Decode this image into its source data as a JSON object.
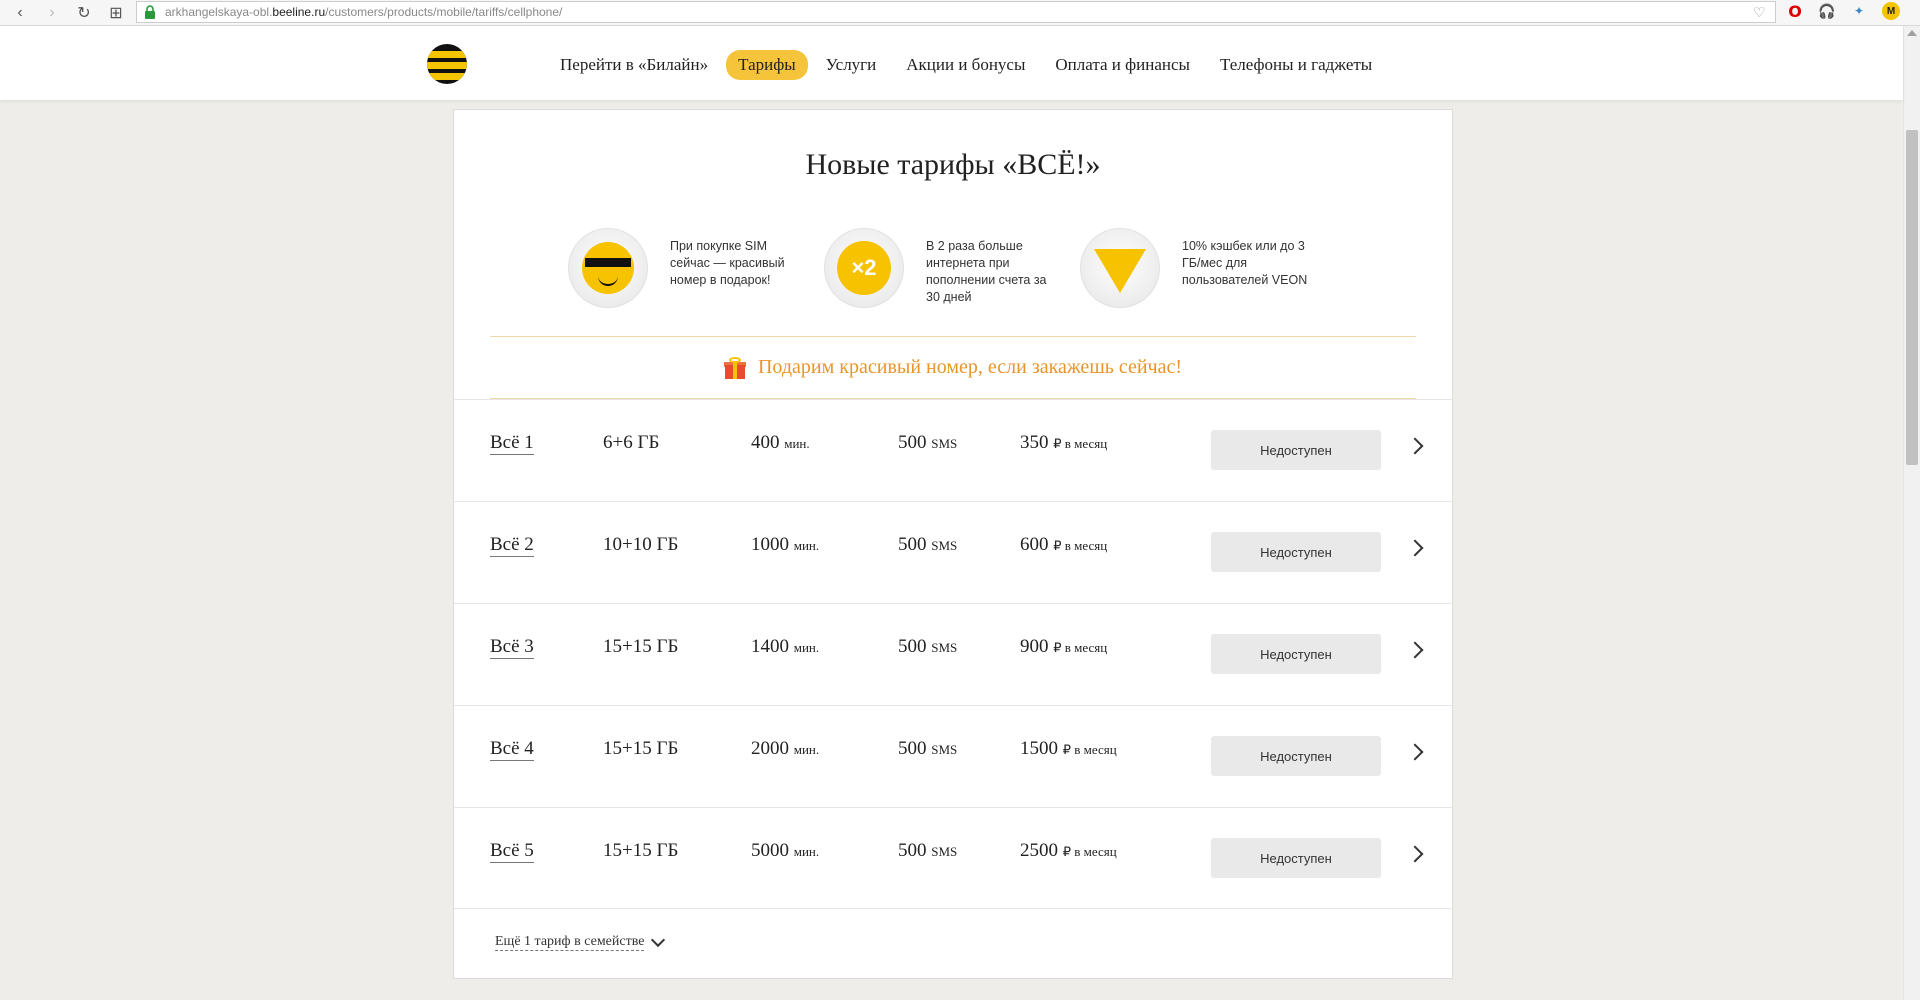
{
  "browser": {
    "url_prefix": "arkhangelskaya-obl.",
    "url_host": "beeline.ru",
    "url_path": "/customers/products/mobile/tariffs/cellphone/",
    "ext_badge_letter": "M"
  },
  "header": {
    "nav": [
      {
        "label": "Перейти в «Билайн»",
        "active": false
      },
      {
        "label": "Тарифы",
        "active": true
      },
      {
        "label": "Услуги",
        "active": false
      },
      {
        "label": "Акции и бонусы",
        "active": false
      },
      {
        "label": "Оплата и финансы",
        "active": false
      },
      {
        "label": "Телефоны и гаджеты",
        "active": false
      }
    ]
  },
  "card": {
    "title": "Новые тарифы «ВСЁ!»",
    "perks": [
      {
        "icon": "smiley-sunglasses-icon",
        "text": "При покупке SIM сейчас — красивый номер в подарок!"
      },
      {
        "icon": "x2-badge-icon",
        "badge": "×2",
        "text": "В 2 раза больше интернета при пополнении счета за 30 дней"
      },
      {
        "icon": "veon-v-icon",
        "text": "10% кэшбек или до 3 ГБ/мес для пользователей VEON"
      }
    ],
    "promo": "Подарим красивый номер, если закажешь сейчас!",
    "tariffs": [
      {
        "name": "Всё 1",
        "gb": "6+6 ГБ",
        "minutes": "400",
        "min_unit": "мин.",
        "sms": "500",
        "sms_unit": "SMS",
        "price": "350",
        "price_unit": "₽ в месяц",
        "button": "Недоступен"
      },
      {
        "name": "Всё 2",
        "gb": "10+10 ГБ",
        "minutes": "1000",
        "min_unit": "мин.",
        "sms": "500",
        "sms_unit": "SMS",
        "price": "600",
        "price_unit": "₽ в месяц",
        "button": "Недоступен"
      },
      {
        "name": "Всё 3",
        "gb": "15+15 ГБ",
        "minutes": "1400",
        "min_unit": "мин.",
        "sms": "500",
        "sms_unit": "SMS",
        "price": "900",
        "price_unit": "₽ в месяц",
        "button": "Недоступен"
      },
      {
        "name": "Всё 4",
        "gb": "15+15 ГБ",
        "minutes": "2000",
        "min_unit": "мин.",
        "sms": "500",
        "sms_unit": "SMS",
        "price": "1500",
        "price_unit": "₽ в месяц",
        "button": "Недоступен"
      },
      {
        "name": "Всё 5",
        "gb": "15+15 ГБ",
        "minutes": "5000",
        "min_unit": "мин.",
        "sms": "500",
        "sms_unit": "SMS",
        "price": "2500",
        "price_unit": "₽ в месяц",
        "button": "Недоступен"
      }
    ],
    "more_label": "Ещё 1 тариф в семействе"
  },
  "colors": {
    "brand_yellow": "#f5c400",
    "promo_orange": "#e8952a",
    "background": "#eeede9"
  }
}
